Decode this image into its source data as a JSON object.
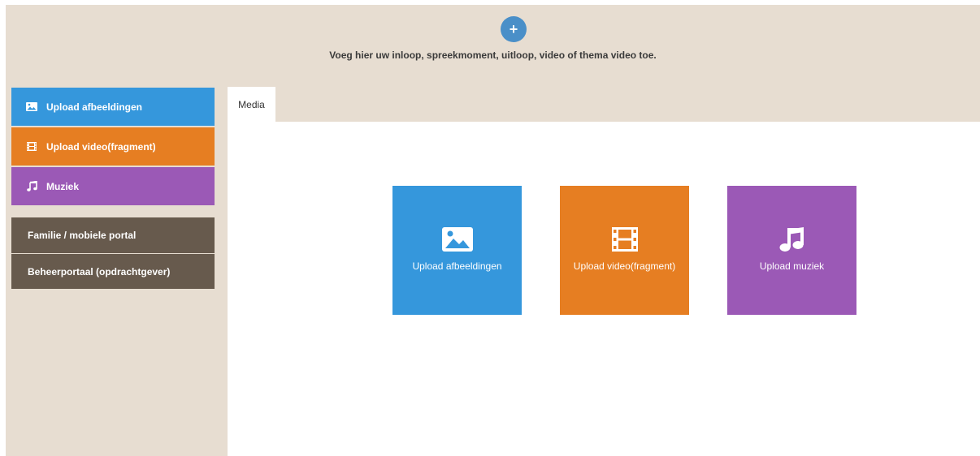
{
  "header": {
    "add_icon": "plus-icon",
    "add_text": "Voeg hier uw inloop, spreekmoment, uitloop, video of thema video toe."
  },
  "sidebar": {
    "items": [
      {
        "label": "Upload afbeeldingen",
        "icon": "image-icon",
        "color": "#3597dc"
      },
      {
        "label": "Upload video(fragment)",
        "icon": "film-icon",
        "color": "#e67e22"
      },
      {
        "label": "Muziek",
        "icon": "music-icon",
        "color": "#9b59b6"
      }
    ],
    "portals": [
      {
        "label": "Familie / mobiele portal"
      },
      {
        "label": "Beheerportaal (opdrachtgever)"
      }
    ]
  },
  "main": {
    "tabs": [
      {
        "label": "Media"
      }
    ],
    "tiles": [
      {
        "label": "Upload afbeeldingen",
        "icon": "image-icon",
        "color": "#3597dc"
      },
      {
        "label": "Upload video(fragment)",
        "icon": "film-icon",
        "color": "#e67e22"
      },
      {
        "label": "Upload muziek",
        "icon": "music-icon",
        "color": "#9b59b6"
      }
    ]
  },
  "colors": {
    "background": "#e7ddd1",
    "portal": "#675a4d",
    "add_button": "#4a8fc8"
  }
}
